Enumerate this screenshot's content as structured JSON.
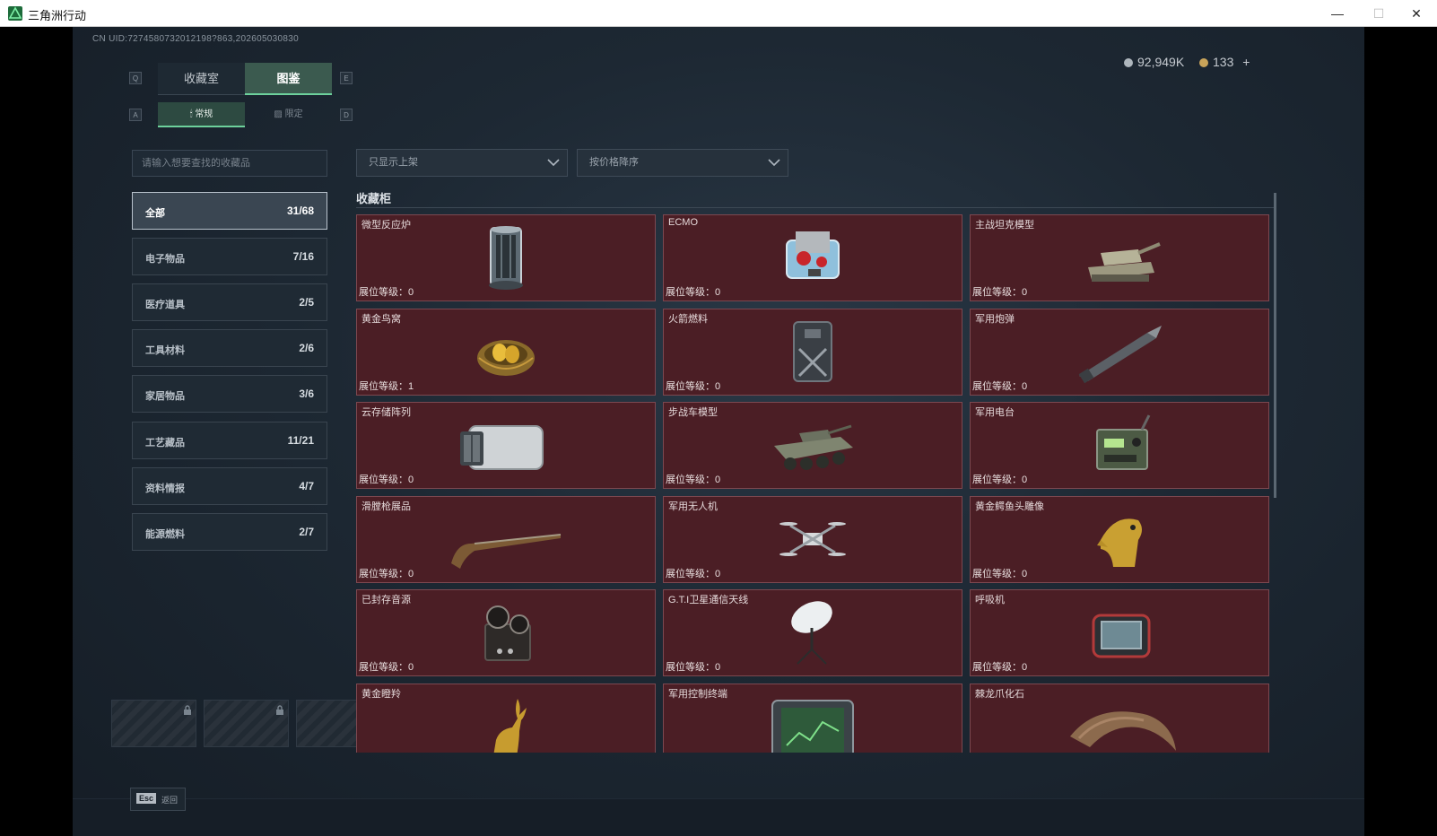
{
  "window": {
    "title": "三角洲行动",
    "min": "—",
    "max": "☐",
    "close": "✕"
  },
  "uid": "CN UID:7274580732012198?863,202605030830",
  "currency": {
    "coins": "92,949K",
    "tokens": "133",
    "plus": "+"
  },
  "keys": {
    "q": "Q",
    "e": "E",
    "a": "A",
    "d": "D"
  },
  "tabs": [
    {
      "label": "收藏室"
    },
    {
      "label": "图鉴"
    }
  ],
  "subtabs": [
    {
      "label": "常规"
    },
    {
      "label": "限定"
    }
  ],
  "search": {
    "placeholder": "请输入想要查找的收藏品"
  },
  "filters": {
    "display": "只显示上架",
    "sort": "按价格降序"
  },
  "categories": [
    {
      "name": "全部",
      "count": "31/68"
    },
    {
      "name": "电子物品",
      "count": "7/16"
    },
    {
      "name": "医疗道具",
      "count": "2/5"
    },
    {
      "name": "工具材料",
      "count": "2/6"
    },
    {
      "name": "家居物品",
      "count": "3/6"
    },
    {
      "name": "工艺藏品",
      "count": "11/21"
    },
    {
      "name": "资料情报",
      "count": "4/7"
    },
    {
      "name": "能源燃料",
      "count": "2/7"
    }
  ],
  "section_title": "收藏柜",
  "level_prefix": "展位等级：",
  "items": [
    {
      "name": "微型反应炉",
      "level": "0",
      "icon": "reactor-icon"
    },
    {
      "name": "ECMO",
      "level": "0",
      "icon": "ecmo-icon"
    },
    {
      "name": "主战坦克模型",
      "level": "0",
      "icon": "tank-icon"
    },
    {
      "name": "黄金鸟窝",
      "level": "1",
      "icon": "golden-nest-icon"
    },
    {
      "name": "火箭燃料",
      "level": "0",
      "icon": "fuel-can-icon"
    },
    {
      "name": "军用炮弹",
      "level": "0",
      "icon": "shell-icon"
    },
    {
      "name": "云存储阵列",
      "level": "0",
      "icon": "storage-array-icon"
    },
    {
      "name": "步战车模型",
      "level": "0",
      "icon": "ifv-icon"
    },
    {
      "name": "军用电台",
      "level": "0",
      "icon": "radio-icon"
    },
    {
      "name": "滑膛枪展品",
      "level": "0",
      "icon": "musket-icon"
    },
    {
      "name": "军用无人机",
      "level": "0",
      "icon": "drone-icon"
    },
    {
      "name": "黄金鳄鱼头雕像",
      "level": "0",
      "icon": "croc-statue-icon"
    },
    {
      "name": "已封存音源",
      "level": "0",
      "icon": "tape-recorder-icon"
    },
    {
      "name": "G.T.I卫星通信天线",
      "level": "0",
      "icon": "satellite-dish-icon"
    },
    {
      "name": "呼吸机",
      "level": "0",
      "icon": "ventilator-icon"
    },
    {
      "name": "黄金瞪羚",
      "level": "",
      "icon": "gazelle-icon"
    },
    {
      "name": "军用控制终端",
      "level": "",
      "icon": "control-terminal-icon"
    },
    {
      "name": "棘龙爪化石",
      "level": "",
      "icon": "claw-fossil-icon"
    }
  ],
  "footer": {
    "esc_key": "Esc",
    "esc_label": "返回"
  }
}
